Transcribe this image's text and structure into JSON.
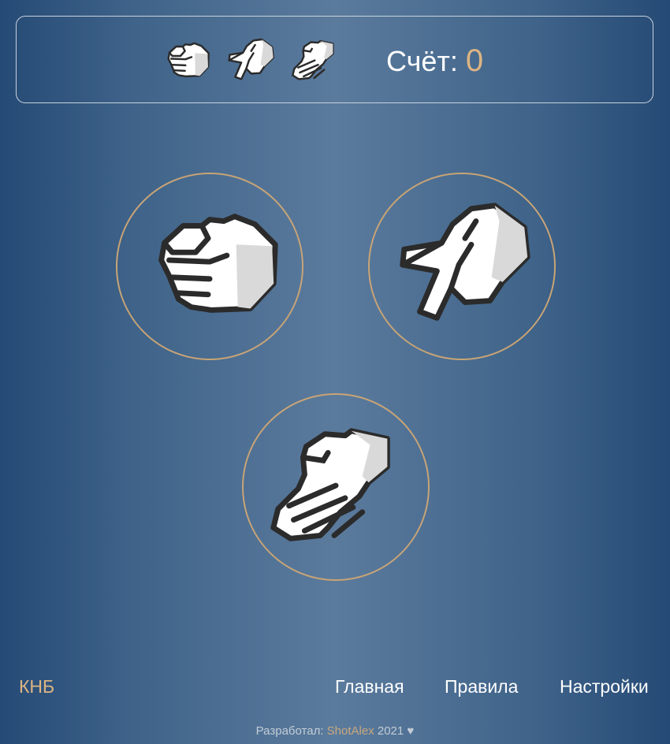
{
  "header": {
    "score_label": "Счёт:",
    "score_value": "0",
    "mini_icons": [
      "fist-icon",
      "scissors-hand-icon",
      "palm-hand-icon"
    ]
  },
  "choices": [
    {
      "name": "rock",
      "icon": "fist-icon"
    },
    {
      "name": "scissors",
      "icon": "scissors-hand-icon"
    },
    {
      "name": "paper",
      "icon": "palm-hand-icon"
    }
  ],
  "nav": {
    "logo": "КНБ",
    "links": [
      "Главная",
      "Правила",
      "Настройки"
    ]
  },
  "footer": {
    "prefix": "Разработал:",
    "author": "ShotAlex",
    "suffix": "2021 ♥"
  },
  "colors": {
    "accent": "#dcb484",
    "circle_border": "#c8a476",
    "text": "#ffffff",
    "background": "#3f6389"
  }
}
